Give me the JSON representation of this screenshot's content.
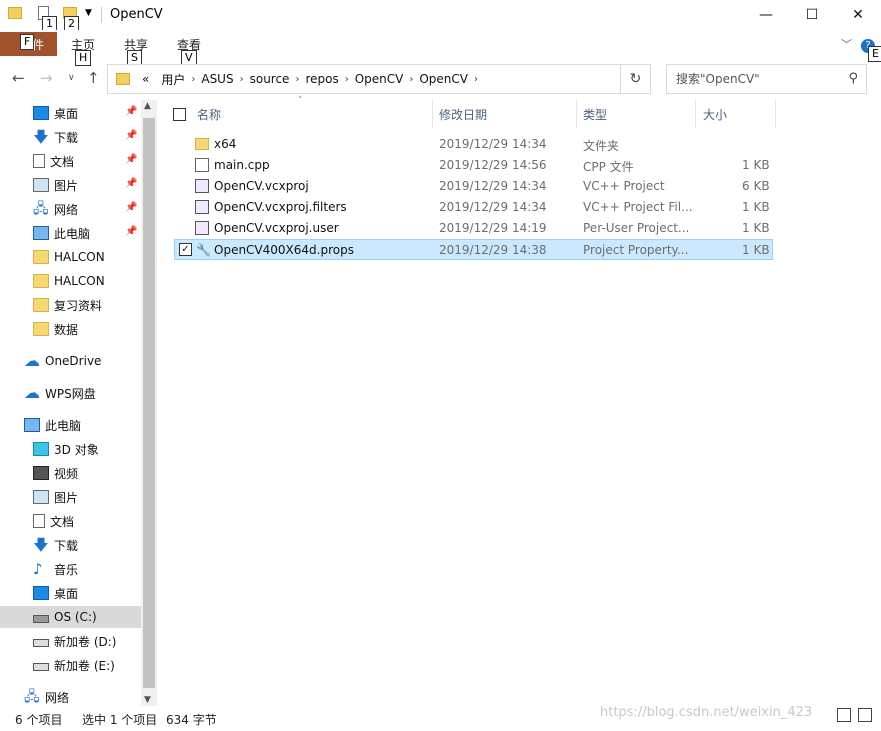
{
  "window": {
    "title": "OpenCV",
    "minimize": "—",
    "maximize": "☐",
    "close": "✕"
  },
  "keytips": {
    "qat1": "1",
    "qat2": "2",
    "file": "F",
    "home": "H",
    "share": "S",
    "view": "V",
    "help": "E"
  },
  "ribbon": {
    "file_label": "文件",
    "tabs": [
      "主页",
      "共享",
      "查看"
    ]
  },
  "address": {
    "overflow": "«",
    "crumbs": [
      "用户",
      "ASUS",
      "source",
      "repos",
      "OpenCV",
      "OpenCV"
    ],
    "search_placeholder": "搜索\"OpenCV\""
  },
  "navpane": {
    "quick_access": [
      {
        "label": "桌面",
        "icon": "desktop-icon",
        "pinned": true
      },
      {
        "label": "下载",
        "icon": "download-icon",
        "pinned": true
      },
      {
        "label": "文档",
        "icon": "document-icon",
        "pinned": true
      },
      {
        "label": "图片",
        "icon": "picture-icon",
        "pinned": true
      },
      {
        "label": "网络",
        "icon": "network-icon",
        "pinned": true
      },
      {
        "label": "此电脑",
        "icon": "computer-icon",
        "pinned": true
      },
      {
        "label": "HALCON",
        "icon": "folder-icon",
        "pinned": false
      },
      {
        "label": "HALCON",
        "icon": "folder-icon",
        "pinned": false
      },
      {
        "label": "复习资料",
        "icon": "folder-icon",
        "pinned": false
      },
      {
        "label": "数据",
        "icon": "folder-icon",
        "pinned": false
      }
    ],
    "onedrive": "OneDrive",
    "wps": "WPS网盘",
    "this_pc": "此电脑",
    "pc_items": [
      {
        "label": "3D 对象",
        "icon": "3d-objects-icon"
      },
      {
        "label": "视频",
        "icon": "video-icon"
      },
      {
        "label": "图片",
        "icon": "picture-icon"
      },
      {
        "label": "文档",
        "icon": "document-icon"
      },
      {
        "label": "下载",
        "icon": "download-icon"
      },
      {
        "label": "音乐",
        "icon": "music-icon"
      },
      {
        "label": "桌面",
        "icon": "desktop-icon"
      },
      {
        "label": "OS (C:)",
        "icon": "drive-icon",
        "selected": true
      },
      {
        "label": "新加卷 (D:)",
        "icon": "drive-icon"
      },
      {
        "label": "新加卷 (E:)",
        "icon": "drive-icon"
      }
    ],
    "network": "网络"
  },
  "columns": {
    "name": "名称",
    "date": "修改日期",
    "type": "类型",
    "size": "大小"
  },
  "files": [
    {
      "name": "x64",
      "date": "2019/12/29 14:34",
      "type": "文件夹",
      "size": "",
      "icon": "folder-icon"
    },
    {
      "name": "main.cpp",
      "date": "2019/12/29 14:56",
      "type": "CPP 文件",
      "size": "1 KB",
      "icon": "cpp-file-icon"
    },
    {
      "name": "OpenCV.vcxproj",
      "date": "2019/12/29 14:34",
      "type": "VC++ Project",
      "size": "6 KB",
      "icon": "vcxproj-icon"
    },
    {
      "name": "OpenCV.vcxproj.filters",
      "date": "2019/12/29 14:34",
      "type": "VC++ Project Fil...",
      "size": "1 KB",
      "icon": "filters-file-icon"
    },
    {
      "name": "OpenCV.vcxproj.user",
      "date": "2019/12/29 14:19",
      "type": "Per-User Project...",
      "size": "1 KB",
      "icon": "user-file-icon"
    },
    {
      "name": "OpenCV400X64d.props",
      "date": "2019/12/29 14:38",
      "type": "Project Property...",
      "size": "1 KB",
      "icon": "props-file-icon",
      "selected": true
    }
  ],
  "status": {
    "count": "6 个项目",
    "selected": "选中 1 个项目",
    "size": "634 字节"
  },
  "watermark": "https://blog.csdn.net/weixin_423"
}
